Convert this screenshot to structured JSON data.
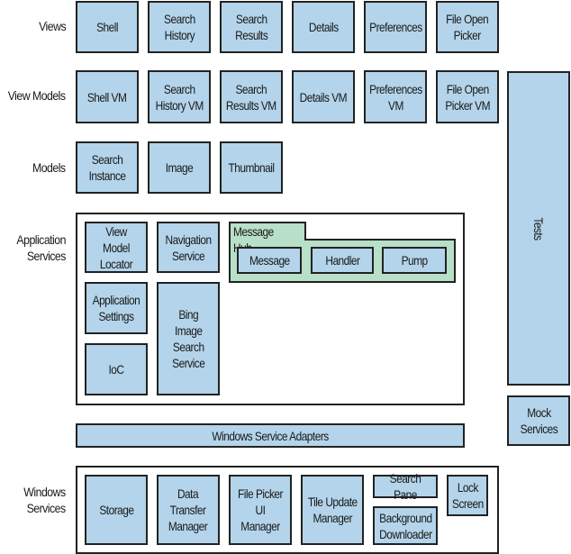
{
  "diagram": {
    "row_labels": {
      "views": "Views",
      "view_models": "View Models",
      "models": "Models",
      "application_services": "Application\nServices",
      "windows_services": "Windows\nServices"
    },
    "views": [
      "Shell",
      "Search\nHistory",
      "Search\nResults",
      "Details",
      "Preferences",
      "File Open\nPicker"
    ],
    "view_models": [
      "Shell VM",
      "Search\nHistory VM",
      "Search\nResults VM",
      "Details VM",
      "Preferences\nVM",
      "File Open\nPicker VM"
    ],
    "models": [
      "Search\nInstance",
      "Image",
      "Thumbnail"
    ],
    "application_services": {
      "view_model_locator": "View Model\nLocator",
      "navigation_service": "Navigation\nService",
      "application_settings": "Application\nSettings",
      "ioc": "IoC",
      "bing_image_search_service": "Bing\nImage\nSearch\nService",
      "message_hub": {
        "title": "Message Hub",
        "items": [
          "Message",
          "Handler",
          "Pump"
        ]
      }
    },
    "windows_service_adapters": "Windows Service Adapters",
    "windows_services": {
      "storage": "Storage",
      "data_transfer_manager": "Data\nTransfer\nManager",
      "file_picker_ui_manager": "File Picker\nUI Manager",
      "tile_update_manager": "Tile Update\nManager",
      "search_pane": "Search Pane",
      "background_downloader": "Background\nDownloader",
      "lock_screen": "Lock\nScreen"
    },
    "tests": "Tests",
    "mock_services": "Mock\nServices",
    "colors": {
      "component_fill": "#b3d4ea",
      "message_hub_fill": "#b8dfc8",
      "border": "#222222",
      "container_fill": "#ffffff"
    }
  }
}
